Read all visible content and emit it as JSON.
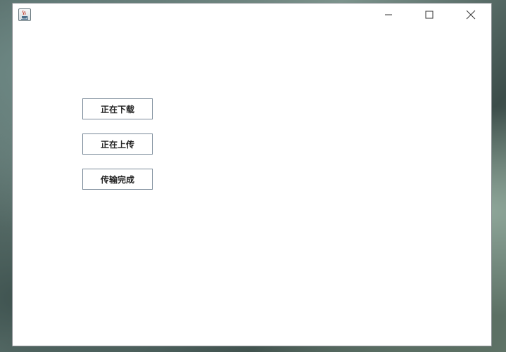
{
  "window": {
    "title": "",
    "icon": "java-coffee-cup-icon",
    "controls": [
      "minimize-icon",
      "maximize-icon",
      "close-icon"
    ]
  },
  "buttons": [
    {
      "label": "正在下载"
    },
    {
      "label": "正在上传"
    },
    {
      "label": "传输完成"
    }
  ],
  "colors": {
    "window_bg": "#ffffff",
    "button_border": "#7a8a99",
    "button_text": "#222222"
  }
}
